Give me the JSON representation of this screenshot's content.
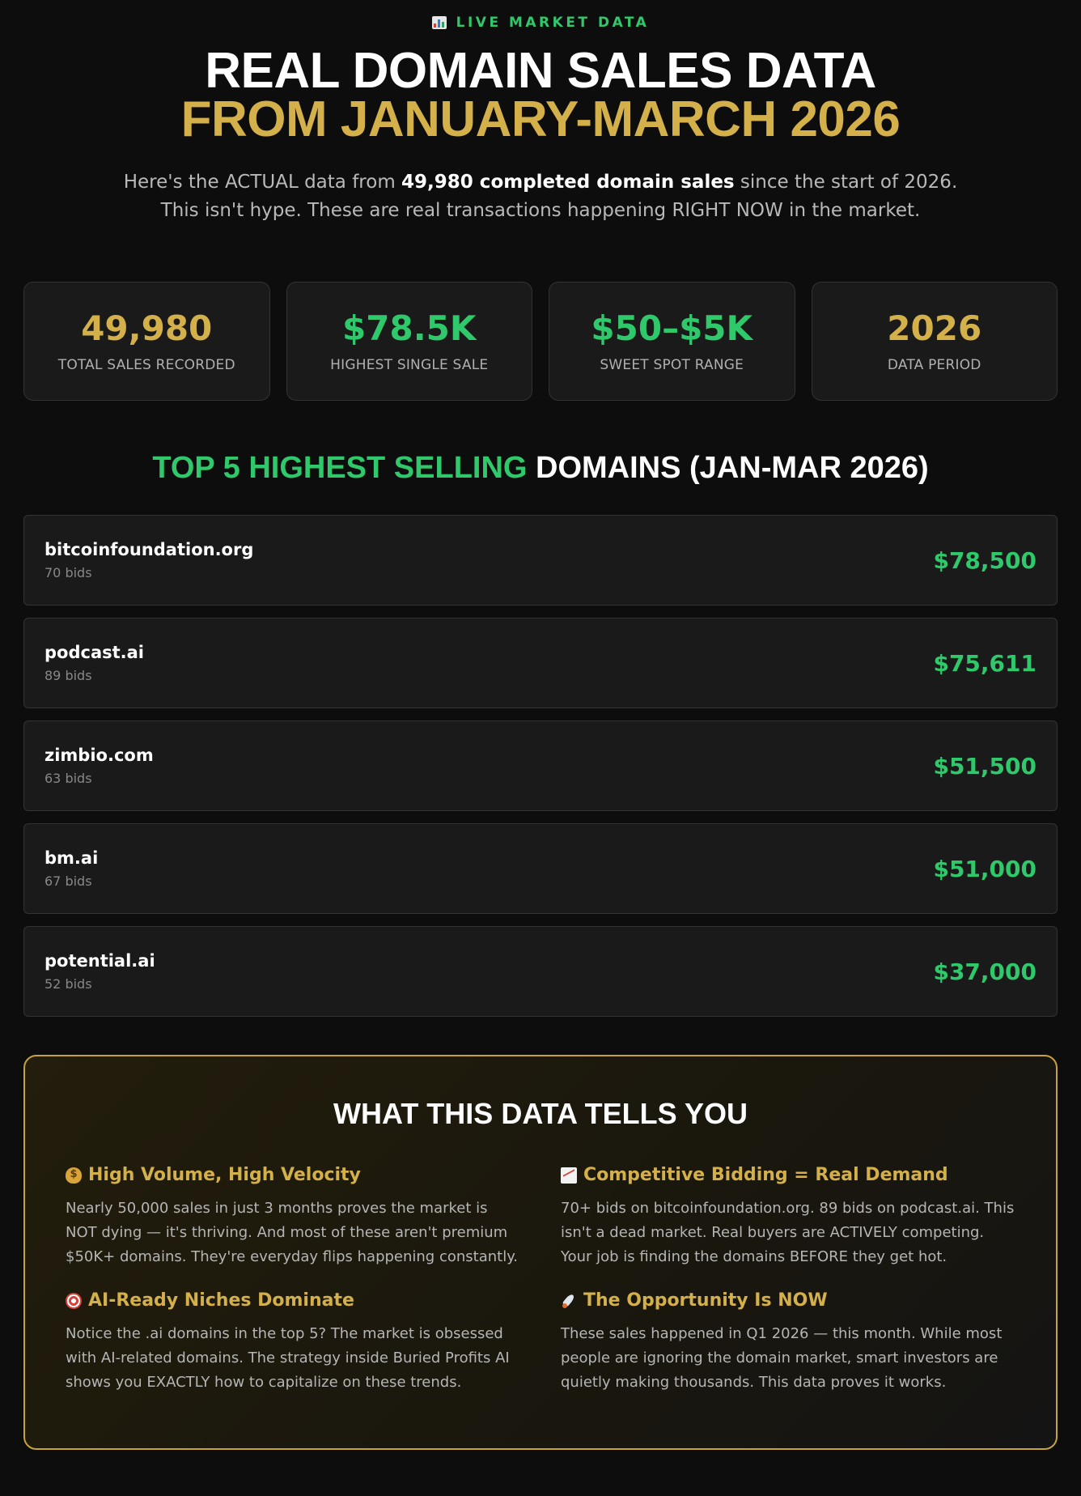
{
  "header": {
    "eyebrow": "LIVE MARKET DATA",
    "eyebrow_icon": "bar-chart-icon",
    "title_line1": "REAL DOMAIN SALES DATA",
    "title_line2": "FROM JANUARY-MARCH 2026",
    "lead_pre": "Here's the ACTUAL data from ",
    "lead_bold": "49,980 completed domain sales",
    "lead_post": " since the start of 2026.",
    "lead_line2": "This isn't hype. These are real transactions happening RIGHT NOW in the market."
  },
  "stats": [
    {
      "value": "49,980",
      "label": "TOTAL SALES RECORDED",
      "color": "#d4b04a"
    },
    {
      "value": "$78.5K",
      "label": "HIGHEST SINGLE SALE",
      "color": "#2fc86a"
    },
    {
      "value": "$50–$5K",
      "label": "SWEET SPOT RANGE",
      "color": "#2fc86a"
    },
    {
      "value": "2026",
      "label": "DATA PERIOD",
      "color": "#d4b04a"
    }
  ],
  "top_domains": {
    "title_green": "TOP 5 HIGHEST SELLING",
    "title_white": " DOMAINS (JAN-MAR 2026)",
    "rows": [
      {
        "name": "bitcoinfoundation.org",
        "bids": "70 bids",
        "price": "$78,500"
      },
      {
        "name": "podcast.ai",
        "bids": "89 bids",
        "price": "$75,611"
      },
      {
        "name": "zimbio.com",
        "bids": "63 bids",
        "price": "$51,500"
      },
      {
        "name": "bm.ai",
        "bids": "67 bids",
        "price": "$51,000"
      },
      {
        "name": "potential.ai",
        "bids": "52 bids",
        "price": "$37,000"
      }
    ]
  },
  "insights": {
    "title": "WHAT THIS DATA TELLS YOU",
    "items": [
      {
        "icon": "money-bag-icon",
        "heading": "High Volume, High Velocity",
        "body": "Nearly 50,000 sales in just 3 months proves the market is NOT dying — it's thriving. And most of these aren't premium $50K+ domains. They're everyday flips happening constantly."
      },
      {
        "icon": "trending-chart-icon",
        "heading": "Competitive Bidding = Real Demand",
        "body": "70+ bids on bitcoinfoundation.org. 89 bids on podcast.ai. This isn't a dead market. Real buyers are ACTIVELY competing. Your job is finding the domains BEFORE they get hot."
      },
      {
        "icon": "target-icon",
        "heading": "AI-Ready Niches Dominate",
        "body": "Notice the .ai domains in the top 5? The market is obsessed with AI-related domains. The strategy inside Buried Profits AI shows you EXACTLY how to capitalize on these trends."
      },
      {
        "icon": "rocket-icon",
        "heading": "The Opportunity Is NOW",
        "body": "These sales happened in Q1 2026 — this month. While most people are ignoring the domain market, smart investors are quietly making thousands. This data proves it works."
      }
    ]
  }
}
